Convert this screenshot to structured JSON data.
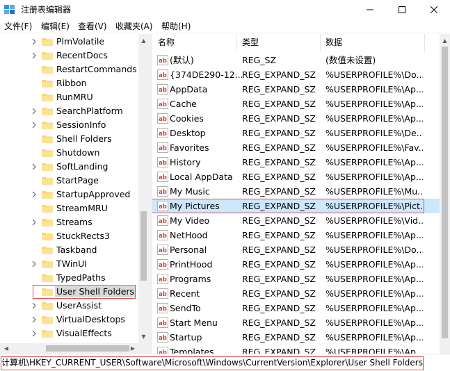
{
  "window": {
    "title": "注册表编辑器"
  },
  "menu": [
    "文件(F)",
    "编辑(E)",
    "查看(V)",
    "收藏夹(A)",
    "帮助(H)"
  ],
  "tree": {
    "items": [
      {
        "label": "PlmVolatile",
        "expandable": true
      },
      {
        "label": "RecentDocs",
        "expandable": true
      },
      {
        "label": "RestartCommands",
        "expandable": false
      },
      {
        "label": "Ribbon",
        "expandable": false
      },
      {
        "label": "RunMRU",
        "expandable": false
      },
      {
        "label": "SearchPlatform",
        "expandable": true
      },
      {
        "label": "SessionInfo",
        "expandable": true
      },
      {
        "label": "Shell Folders",
        "expandable": false
      },
      {
        "label": "Shutdown",
        "expandable": false
      },
      {
        "label": "SoftLanding",
        "expandable": true
      },
      {
        "label": "StartPage",
        "expandable": false
      },
      {
        "label": "StartupApproved",
        "expandable": true
      },
      {
        "label": "StreamMRU",
        "expandable": false
      },
      {
        "label": "Streams",
        "expandable": true
      },
      {
        "label": "StuckRects3",
        "expandable": false
      },
      {
        "label": "Taskband",
        "expandable": false
      },
      {
        "label": "TWinUI",
        "expandable": true
      },
      {
        "label": "TypedPaths",
        "expandable": false
      },
      {
        "label": "User Shell Folders",
        "expandable": false,
        "selected": true
      },
      {
        "label": "UserAssist",
        "expandable": true
      },
      {
        "label": "VirtualDesktops",
        "expandable": true
      },
      {
        "label": "VisualEffects",
        "expandable": true
      }
    ]
  },
  "list": {
    "headers": {
      "name": "名称",
      "type": "类型",
      "data": "数据"
    },
    "rows": [
      {
        "name": "(默认)",
        "type": "REG_SZ",
        "data": "(数值未设置)"
      },
      {
        "name": "{374DE290-12...",
        "type": "REG_EXPAND_SZ",
        "data": "%USERPROFILE%\\Do..."
      },
      {
        "name": "AppData",
        "type": "REG_EXPAND_SZ",
        "data": "%USERPROFILE%\\Ap..."
      },
      {
        "name": "Cache",
        "type": "REG_EXPAND_SZ",
        "data": "%USERPROFILE%\\Ap..."
      },
      {
        "name": "Cookies",
        "type": "REG_EXPAND_SZ",
        "data": "%USERPROFILE%\\Ap..."
      },
      {
        "name": "Desktop",
        "type": "REG_EXPAND_SZ",
        "data": "%USERPROFILE%\\De..."
      },
      {
        "name": "Favorites",
        "type": "REG_EXPAND_SZ",
        "data": "%USERPROFILE%\\Fav..."
      },
      {
        "name": "History",
        "type": "REG_EXPAND_SZ",
        "data": "%USERPROFILE%\\Ap..."
      },
      {
        "name": "Local AppData",
        "type": "REG_EXPAND_SZ",
        "data": "%USERPROFILE%\\Ap..."
      },
      {
        "name": "My Music",
        "type": "REG_EXPAND_SZ",
        "data": "%USERPROFILE%\\Mu..."
      },
      {
        "name": "My Pictures",
        "type": "REG_EXPAND_SZ",
        "data": "%USERPROFILE%\\Pict...",
        "selected": true
      },
      {
        "name": "My Video",
        "type": "REG_EXPAND_SZ",
        "data": "%USERPROFILE%\\Vid..."
      },
      {
        "name": "NetHood",
        "type": "REG_EXPAND_SZ",
        "data": "%USERPROFILE%\\Ap..."
      },
      {
        "name": "Personal",
        "type": "REG_EXPAND_SZ",
        "data": "%USERPROFILE%\\Do..."
      },
      {
        "name": "PrintHood",
        "type": "REG_EXPAND_SZ",
        "data": "%USERPROFILE%\\Ap..."
      },
      {
        "name": "Programs",
        "type": "REG_EXPAND_SZ",
        "data": "%USERPROFILE%\\Ap..."
      },
      {
        "name": "Recent",
        "type": "REG_EXPAND_SZ",
        "data": "%USERPROFILE%\\Ap..."
      },
      {
        "name": "SendTo",
        "type": "REG_EXPAND_SZ",
        "data": "%USERPROFILE%\\Ap..."
      },
      {
        "name": "Start Menu",
        "type": "REG_EXPAND_SZ",
        "data": "%USERPROFILE%\\Ap..."
      },
      {
        "name": "Startup",
        "type": "REG_EXPAND_SZ",
        "data": "%USERPROFILE%\\Ap..."
      },
      {
        "name": "Templates",
        "type": "REG_EXPAND_SZ",
        "data": "%USERPROFILE%\\Ap..."
      }
    ]
  },
  "status": {
    "path": "计算机\\HKEY_CURRENT_USER\\Software\\Microsoft\\Windows\\CurrentVersion\\Explorer\\User Shell Folders"
  },
  "icons": {
    "app": "registry-editor-icon",
    "minimize": "minimize-icon",
    "maximize": "maximize-icon",
    "close": "close-icon",
    "folder": "folder-icon",
    "expander": "chevron-right-icon",
    "string_value": "string-value-icon"
  },
  "colors": {
    "folder": "#f8d775",
    "selection": "#cce8ff",
    "highlight_box": "#e0484c",
    "value_icon": "#c8463d"
  }
}
